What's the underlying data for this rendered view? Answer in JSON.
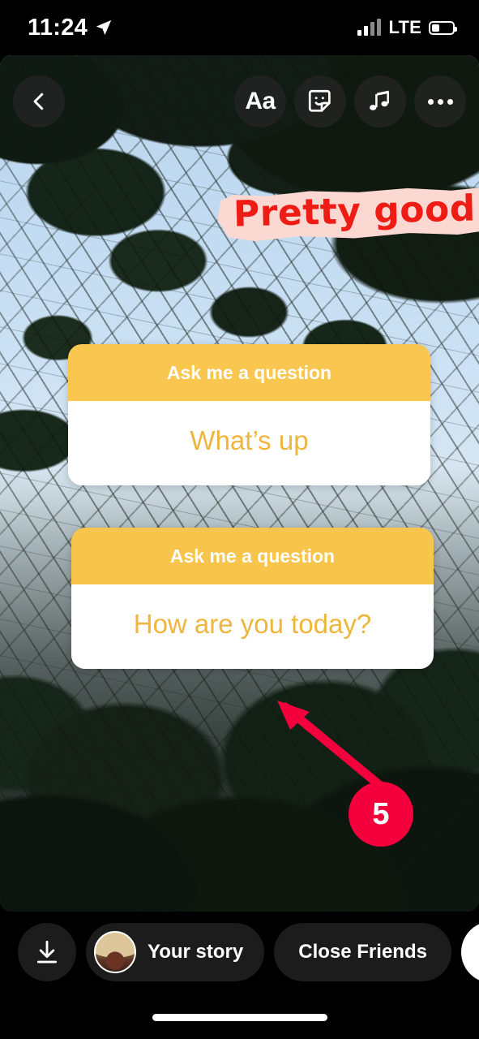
{
  "status_bar": {
    "time": "11:24",
    "location_icon": "location-arrow-icon",
    "network": "LTE",
    "signal_icon": "signal-bars-icon",
    "battery_icon": "battery-icon"
  },
  "toolbar": {
    "back_icon": "chevron-left-icon",
    "text_tool_label": "Aa",
    "sticker_icon": "sticker-smiley-icon",
    "music_icon": "music-note-icon",
    "more_icon": "three-dots-icon"
  },
  "text_overlay": {
    "text": "Pretty good",
    "text_color": "#ef1c16",
    "highlight_color": "#fbd9d2"
  },
  "question_stickers": [
    {
      "prompt": "Ask me a question",
      "answer": "What’s up",
      "header_color": "#f9c74f",
      "answer_color": "#eeb63d",
      "body_color": "#ffffff"
    },
    {
      "prompt": "Ask me a question",
      "answer": "How are you today?",
      "header_color": "#f8c54c",
      "answer_color": "#eeb63d",
      "body_color": "#ffffff"
    }
  ],
  "annotation": {
    "step_number": "5",
    "badge_color": "#f4003c",
    "arrow_icon": "arrow-up-left-icon"
  },
  "bottom_bar": {
    "save_icon": "download-icon",
    "your_story_label": "Your story",
    "avatar": "user-avatar",
    "close_friends_label": "Close Friends",
    "send_icon": "arrow-right-icon"
  },
  "system": {
    "home_indicator": "home-indicator"
  }
}
